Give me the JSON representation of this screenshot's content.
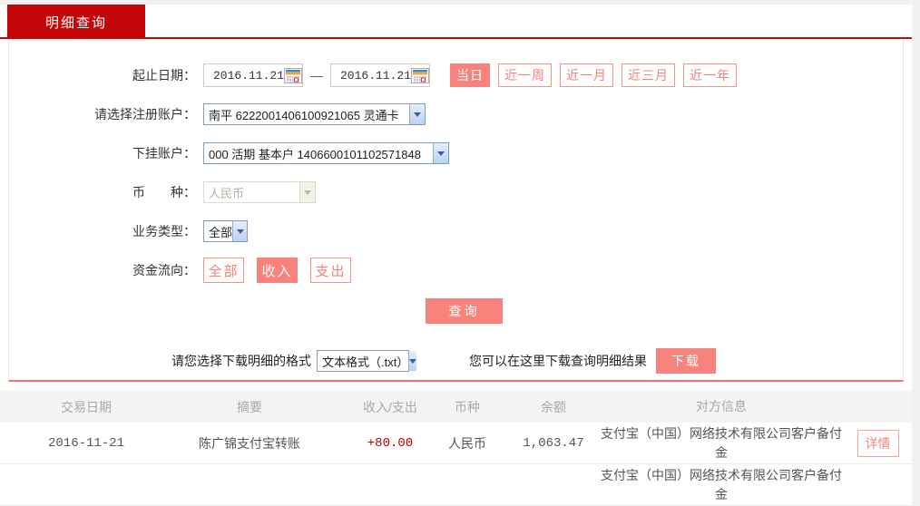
{
  "tab": {
    "title": "明细查询"
  },
  "form": {
    "date": {
      "label": "起止日期：",
      "start_value": "2016.11.21",
      "end_value": "2016.11.21",
      "separator": "—",
      "quick": [
        {
          "label": "当日",
          "active": true
        },
        {
          "label": "近一周",
          "active": false
        },
        {
          "label": "近一月",
          "active": false
        },
        {
          "label": "近三月",
          "active": false
        },
        {
          "label": "近一年",
          "active": false
        }
      ]
    },
    "register_account": {
      "label": "请选择注册账户：",
      "value": "南平 6222001406100921065 灵通卡"
    },
    "sub_account": {
      "label": "下挂账户：",
      "value": "000 活期 基本户 1406600101102571848"
    },
    "currency": {
      "label": "币　　种：",
      "value": "人民币",
      "disabled": true
    },
    "business_type": {
      "label": "业务类型：",
      "value": "全部"
    },
    "fund_flow": {
      "label": "资金流向：",
      "options": [
        {
          "label": "全部",
          "active": false
        },
        {
          "label": "收入",
          "active": true
        },
        {
          "label": "支出",
          "active": false
        }
      ]
    },
    "query_button": "查询"
  },
  "download": {
    "format_label": "请您选择下载明细的格式",
    "format_value": "文本格式（.txt）",
    "hint": "您可以在这里下载查询明细结果",
    "button": "下载"
  },
  "table": {
    "headers": [
      "交易日期",
      "摘要",
      "收入/支出",
      "币种",
      "余额",
      "对方信息"
    ],
    "rows": [
      {
        "date": "2016-11-21",
        "summary": "陈广锦支付宝转账",
        "amount": "+80.00",
        "currency": "人民币",
        "balance": "1,063.47",
        "counterparty": "支付宝（中国）网络技术有限公司客户备付金",
        "action": "详情"
      },
      {
        "counterparty": "支付宝（中国）网络技术有限公司客户备付金"
      }
    ]
  },
  "colors": {
    "tab_red": "#c40808",
    "accent_salmon": "#f8837c",
    "income_red": "#c00000"
  }
}
